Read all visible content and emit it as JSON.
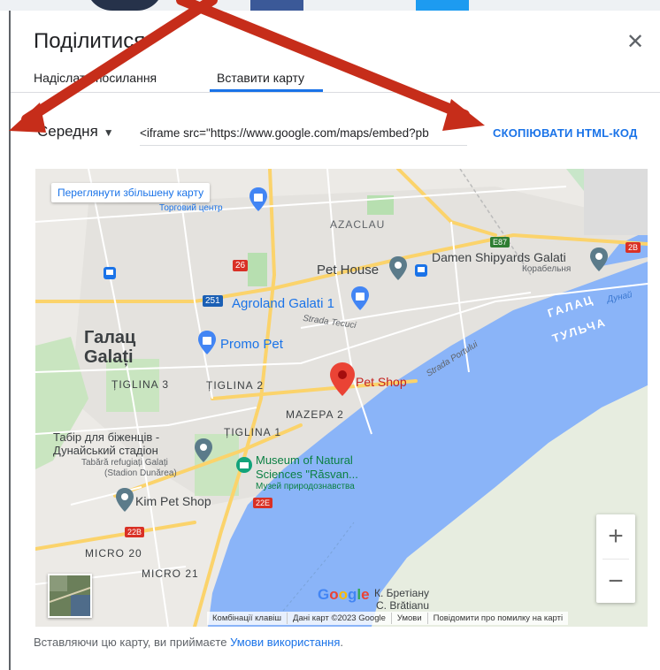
{
  "dialog": {
    "title": "Поділитися",
    "close_symbol": "✕",
    "tabs": [
      {
        "label": "Надіслати посилання",
        "active": false
      },
      {
        "label": "Вставити карту",
        "active": true
      }
    ]
  },
  "embed": {
    "size_label": "Середня",
    "size_caret": "▼",
    "code_value": "<iframe src=\"https://www.google.com/maps/embed?pb",
    "copy_label": "СКОПІЮВАТИ HTML-КОД"
  },
  "map": {
    "enlarge_link": "Переглянути збільшену карту",
    "zoom_in": "+",
    "zoom_out": "−",
    "labels": {
      "torhovyi_tsentr": "Торговий центр",
      "azaclau": "AZACLAU",
      "pet_house": "Pet House",
      "damen": "Damen Shipyards Galati",
      "korabelnia": "Корабельня",
      "agroland": "Agroland Galati 1",
      "strada_tecuci": "Strada Tecuci",
      "galats": "Галац",
      "galati": "Galați",
      "promo_pet": "Promo Pet",
      "galats_river": "ГАЛАЦ",
      "tulcha": "ТУЛЬЧА",
      "dunai": "Дунай",
      "strada_portului": "Strada Portului",
      "tiglina3": "ȚIGLINA 3",
      "tiglina2": "ȚIGLINA 2",
      "pet_shop": "Pet Shop",
      "mazepa2": "MAZEPA 2",
      "tiglina1": "ȚIGLINA 1",
      "tabir1": "Табір для біженців -",
      "tabir2": "Дунайський стадіон",
      "tabara1": "Tabără refugiați Galați",
      "tabara2": "(Stadion Dunărea)",
      "museum1": "Museum of Natural",
      "museum2": "Sciences \"Răsvan...",
      "muzei": "Музей природознавства",
      "kim_pet": "Kim Pet Shop",
      "micro20": "MICRO 20",
      "micro21": "MICRO 21",
      "bretianu": "К. Бретіану",
      "bratianu": "C. Brătianu",
      "road_26": "26",
      "road_251": "251",
      "road_e87": "E87",
      "road_2b": "2B",
      "road_22e": "22E",
      "road_22b": "22B",
      "google": "Google"
    },
    "footer": [
      "Комбінації клавіш",
      "Дані карт ©2023 Google",
      "Умови",
      "Повідомити про помилку на карті"
    ]
  },
  "terms": {
    "prefix": "Вставляючи цю карту, ви приймаєте",
    "link": "Умови використання",
    "suffix": "."
  },
  "colors": {
    "accent": "#1a73e8",
    "water": "#8ab4f8",
    "park": "#b7dfb0",
    "road_major": "#fbd36b",
    "arrow": "#d32f1f",
    "pin_red": "#ea4335",
    "pin_blue": "#4285f4",
    "pin_gray": "#5b7b8a",
    "road_sign_blue": "#1a5fb4",
    "road_sign_red": "#d93025"
  }
}
